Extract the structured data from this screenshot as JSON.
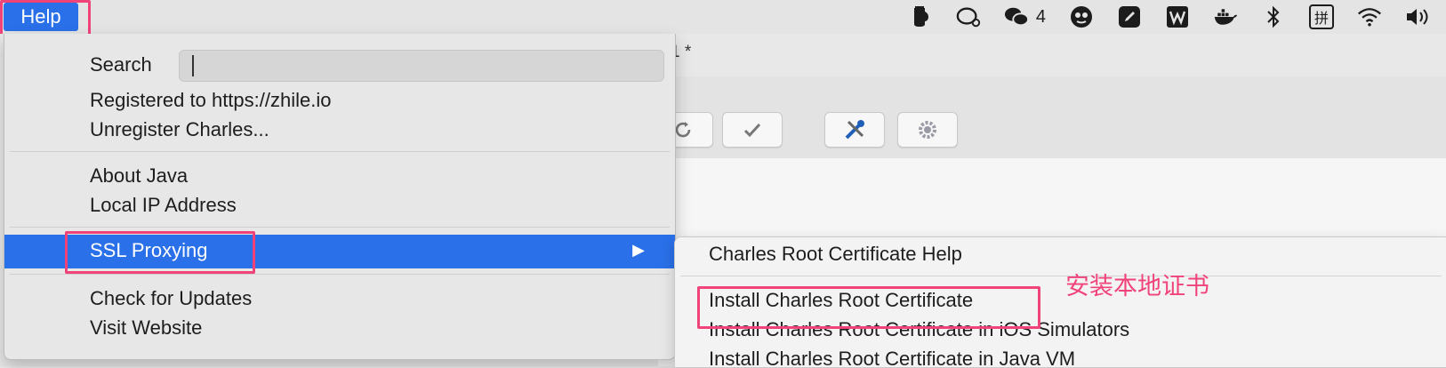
{
  "menubar": {
    "help_label": "Help",
    "status_icons": [
      "jar-icon",
      "chat-bubble-icon",
      "wechat-icon",
      "qq-icon",
      "notes-icon",
      "wps-icon",
      "docker-icon",
      "bluetooth-icon",
      "input-method-icon",
      "wifi-icon",
      "volume-icon"
    ],
    "wechat_badge": "4",
    "input_method_glyph": "拼"
  },
  "background_window": {
    "title_fragment": "1 *"
  },
  "help_menu": {
    "search_label": "Search",
    "search_value": "",
    "items": [
      {
        "label": "Registered to https://zhile.io"
      },
      {
        "label": "Unregister Charles..."
      },
      {
        "label": "About Java"
      },
      {
        "label": "Local IP Address"
      },
      {
        "label": "SSL Proxying",
        "selected": true,
        "has_submenu": true
      },
      {
        "label": "Check for Updates"
      },
      {
        "label": "Visit Website"
      }
    ]
  },
  "ssl_submenu": {
    "items": [
      {
        "label": "Charles Root Certificate Help"
      },
      {
        "label": "Install Charles Root Certificate"
      },
      {
        "label": "Install Charles Root Certificate in iOS Simulators"
      },
      {
        "label": "Install Charles Root Certificate in Java VM"
      }
    ]
  },
  "annotation": {
    "text": "安装本地证书"
  },
  "colors": {
    "selection": "#2a70e8",
    "highlight_box": "#f0437a",
    "annotation": "#f0437a"
  }
}
